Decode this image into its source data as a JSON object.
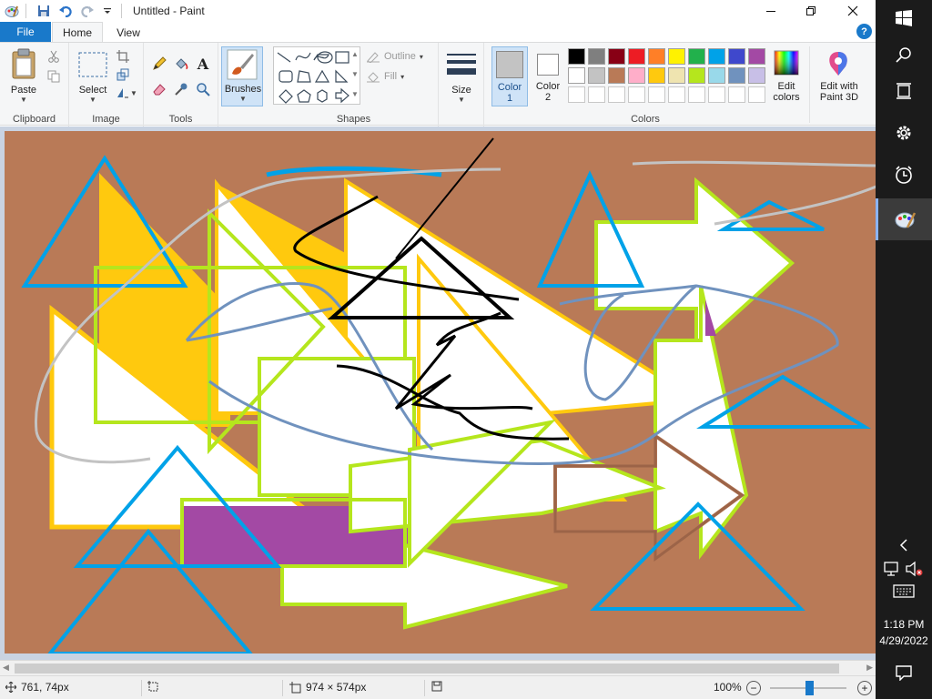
{
  "window": {
    "title": "Untitled - Paint",
    "quick_access": [
      "paint-app-icon",
      "save-icon",
      "undo-icon",
      "redo-icon",
      "customize-quick-access-icon"
    ]
  },
  "tabs": {
    "file": "File",
    "home": "Home",
    "view": "View",
    "help": "?"
  },
  "ribbon": {
    "clipboard": {
      "paste": "Paste",
      "group": "Clipboard"
    },
    "image": {
      "select": "Select",
      "group": "Image"
    },
    "tools": {
      "group": "Tools"
    },
    "brushes": {
      "label": "Brushes"
    },
    "shapes": {
      "outline": "Outline",
      "fill": "Fill",
      "group": "Shapes"
    },
    "size": {
      "label": "Size"
    },
    "colors": {
      "color1": "Color",
      "color1_num": "1",
      "color2": "Color",
      "color2_num": "2",
      "edit_colors": "Edit",
      "edit_colors_2": "colors",
      "group": "Colors",
      "color1_value": "#c3c3c3",
      "color2_value": "#ffffff",
      "palette_row1": [
        "#000000",
        "#7f7f7f",
        "#880015",
        "#ed1c24",
        "#ff7f27",
        "#fff200",
        "#22b14c",
        "#00a2e8",
        "#3f48cc",
        "#a349a4"
      ],
      "palette_row2": [
        "#ffffff",
        "#c3c3c3",
        "#b97a57",
        "#ffaec9",
        "#ffc90e",
        "#efe4b0",
        "#b5e61d",
        "#99d9ea",
        "#7092be",
        "#c8bfe7"
      ]
    },
    "paint3d": {
      "line1": "Edit with",
      "line2": "Paint 3D"
    }
  },
  "canvas": {
    "background": "#b97a57"
  },
  "status": {
    "cursor_pos": "761, 74px",
    "selection_size": "",
    "image_size": "974 × 574px",
    "zoom": "100%",
    "zoom_fraction": 0.4
  },
  "taskbar": {
    "time": "1:18 PM",
    "date": "4/29/2022"
  }
}
